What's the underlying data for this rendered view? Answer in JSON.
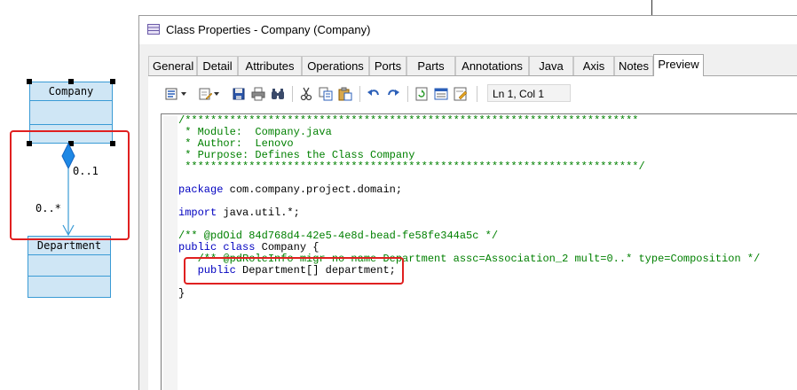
{
  "diagram": {
    "class_company": "Company",
    "class_department": "Department",
    "mult_source": "0..1",
    "mult_target": "0..*"
  },
  "window": {
    "title": "Class Properties - Company (Company)",
    "tabs": [
      "General",
      "Detail",
      "Attributes",
      "Operations",
      "Ports",
      "Parts",
      "Annotations",
      "Java",
      "Axis",
      "Notes",
      "Preview"
    ],
    "active_tab": "Preview",
    "position": "Ln 1, Col 1"
  },
  "toolbar_icons": [
    "edit-menu-icon",
    "edit-file-icon",
    "save-icon",
    "print-icon",
    "find-icon",
    "cut-icon",
    "copy-icon",
    "paste-icon",
    "undo-icon",
    "redo-icon",
    "refresh-icon",
    "show-generation-options-icon",
    "edit-with-icon"
  ],
  "code": {
    "line1": "/***********************************************************************",
    "line2": " * Module:  Company.java",
    "line3": " * Author:  Lenovo",
    "line4": " * Purpose: Defines the Class Company",
    "line5": " ***********************************************************************/",
    "line_package_kw": "package",
    "line_package_rest": " com.company.project.domain;",
    "line_import_kw": "import",
    "line_import_rest": " java.util.*;",
    "line_oid": "/** @pdOid 84d768d4-42e5-4e8d-bead-fe58fe344a5c */",
    "line_class_kw": "public class",
    "line_class_rest": " Company {",
    "line_role": "   /** @pdRoleInfo migr no name Department assc=Association_2 mult=0..* type=Composition */",
    "line_field_kw": "   public",
    "line_field_rest": " Department[] department;",
    "line_close": "}"
  },
  "colors": {
    "highlight": "#e02020",
    "uml_fill": "#cfe6f5",
    "uml_border": "#3a9bd5",
    "comment": "#008000",
    "keyword": "#0000c0"
  }
}
